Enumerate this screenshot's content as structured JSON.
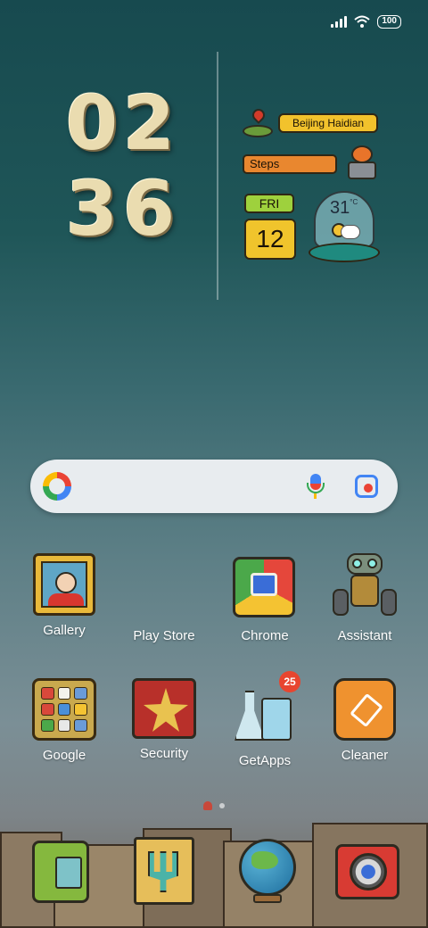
{
  "status_bar": {
    "battery": "100",
    "signal_icon": "signal-icon",
    "wifi_icon": "wifi-icon"
  },
  "clock": {
    "hour_1": "0",
    "hour_2": "2",
    "minute_1": "3",
    "minute_2": "6"
  },
  "weather_widget": {
    "location": "Beijing Haidian",
    "steps_label": "Steps",
    "day": "FRI",
    "date": "12",
    "temperature": "31",
    "unit": "°C"
  },
  "search_bar": {
    "logo": "google-g-icon",
    "mic": "mic-icon",
    "lens": "camera-lens-icon"
  },
  "apps": [
    {
      "label": "Gallery"
    },
    {
      "label": "Play Store"
    },
    {
      "label": "Chrome"
    },
    {
      "label": "Assistant"
    },
    {
      "label": "Google"
    },
    {
      "label": "Security"
    },
    {
      "label": "GetApps",
      "badge": "25"
    },
    {
      "label": "Cleaner"
    }
  ],
  "dock": [
    "phone-icon",
    "notes-icon",
    "browser-globe-icon",
    "camera-icon"
  ],
  "colors": {
    "accent_yellow": "#f2c22c",
    "accent_orange": "#e9872f",
    "accent_green": "#9ed13d",
    "badge_red": "#e8452f"
  }
}
